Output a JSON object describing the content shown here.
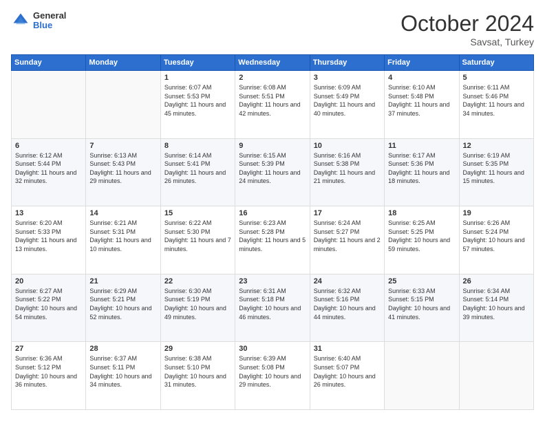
{
  "header": {
    "logo": {
      "general": "General",
      "blue": "Blue"
    },
    "title": "October 2024",
    "subtitle": "Savsat, Turkey"
  },
  "weekdays": [
    "Sunday",
    "Monday",
    "Tuesday",
    "Wednesday",
    "Thursday",
    "Friday",
    "Saturday"
  ],
  "weeks": [
    [
      {
        "day": null
      },
      {
        "day": null
      },
      {
        "day": "1",
        "sunrise": "6:07 AM",
        "sunset": "5:53 PM",
        "daylight": "11 hours and 45 minutes."
      },
      {
        "day": "2",
        "sunrise": "6:08 AM",
        "sunset": "5:51 PM",
        "daylight": "11 hours and 42 minutes."
      },
      {
        "day": "3",
        "sunrise": "6:09 AM",
        "sunset": "5:49 PM",
        "daylight": "11 hours and 40 minutes."
      },
      {
        "day": "4",
        "sunrise": "6:10 AM",
        "sunset": "5:48 PM",
        "daylight": "11 hours and 37 minutes."
      },
      {
        "day": "5",
        "sunrise": "6:11 AM",
        "sunset": "5:46 PM",
        "daylight": "11 hours and 34 minutes."
      }
    ],
    [
      {
        "day": "6",
        "sunrise": "6:12 AM",
        "sunset": "5:44 PM",
        "daylight": "11 hours and 32 minutes."
      },
      {
        "day": "7",
        "sunrise": "6:13 AM",
        "sunset": "5:43 PM",
        "daylight": "11 hours and 29 minutes."
      },
      {
        "day": "8",
        "sunrise": "6:14 AM",
        "sunset": "5:41 PM",
        "daylight": "11 hours and 26 minutes."
      },
      {
        "day": "9",
        "sunrise": "6:15 AM",
        "sunset": "5:39 PM",
        "daylight": "11 hours and 24 minutes."
      },
      {
        "day": "10",
        "sunrise": "6:16 AM",
        "sunset": "5:38 PM",
        "daylight": "11 hours and 21 minutes."
      },
      {
        "day": "11",
        "sunrise": "6:17 AM",
        "sunset": "5:36 PM",
        "daylight": "11 hours and 18 minutes."
      },
      {
        "day": "12",
        "sunrise": "6:19 AM",
        "sunset": "5:35 PM",
        "daylight": "11 hours and 15 minutes."
      }
    ],
    [
      {
        "day": "13",
        "sunrise": "6:20 AM",
        "sunset": "5:33 PM",
        "daylight": "11 hours and 13 minutes."
      },
      {
        "day": "14",
        "sunrise": "6:21 AM",
        "sunset": "5:31 PM",
        "daylight": "11 hours and 10 minutes."
      },
      {
        "day": "15",
        "sunrise": "6:22 AM",
        "sunset": "5:30 PM",
        "daylight": "11 hours and 7 minutes."
      },
      {
        "day": "16",
        "sunrise": "6:23 AM",
        "sunset": "5:28 PM",
        "daylight": "11 hours and 5 minutes."
      },
      {
        "day": "17",
        "sunrise": "6:24 AM",
        "sunset": "5:27 PM",
        "daylight": "11 hours and 2 minutes."
      },
      {
        "day": "18",
        "sunrise": "6:25 AM",
        "sunset": "5:25 PM",
        "daylight": "10 hours and 59 minutes."
      },
      {
        "day": "19",
        "sunrise": "6:26 AM",
        "sunset": "5:24 PM",
        "daylight": "10 hours and 57 minutes."
      }
    ],
    [
      {
        "day": "20",
        "sunrise": "6:27 AM",
        "sunset": "5:22 PM",
        "daylight": "10 hours and 54 minutes."
      },
      {
        "day": "21",
        "sunrise": "6:29 AM",
        "sunset": "5:21 PM",
        "daylight": "10 hours and 52 minutes."
      },
      {
        "day": "22",
        "sunrise": "6:30 AM",
        "sunset": "5:19 PM",
        "daylight": "10 hours and 49 minutes."
      },
      {
        "day": "23",
        "sunrise": "6:31 AM",
        "sunset": "5:18 PM",
        "daylight": "10 hours and 46 minutes."
      },
      {
        "day": "24",
        "sunrise": "6:32 AM",
        "sunset": "5:16 PM",
        "daylight": "10 hours and 44 minutes."
      },
      {
        "day": "25",
        "sunrise": "6:33 AM",
        "sunset": "5:15 PM",
        "daylight": "10 hours and 41 minutes."
      },
      {
        "day": "26",
        "sunrise": "6:34 AM",
        "sunset": "5:14 PM",
        "daylight": "10 hours and 39 minutes."
      }
    ],
    [
      {
        "day": "27",
        "sunrise": "6:36 AM",
        "sunset": "5:12 PM",
        "daylight": "10 hours and 36 minutes."
      },
      {
        "day": "28",
        "sunrise": "6:37 AM",
        "sunset": "5:11 PM",
        "daylight": "10 hours and 34 minutes."
      },
      {
        "day": "29",
        "sunrise": "6:38 AM",
        "sunset": "5:10 PM",
        "daylight": "10 hours and 31 minutes."
      },
      {
        "day": "30",
        "sunrise": "6:39 AM",
        "sunset": "5:08 PM",
        "daylight": "10 hours and 29 minutes."
      },
      {
        "day": "31",
        "sunrise": "6:40 AM",
        "sunset": "5:07 PM",
        "daylight": "10 hours and 26 minutes."
      },
      {
        "day": null
      },
      {
        "day": null
      }
    ]
  ]
}
